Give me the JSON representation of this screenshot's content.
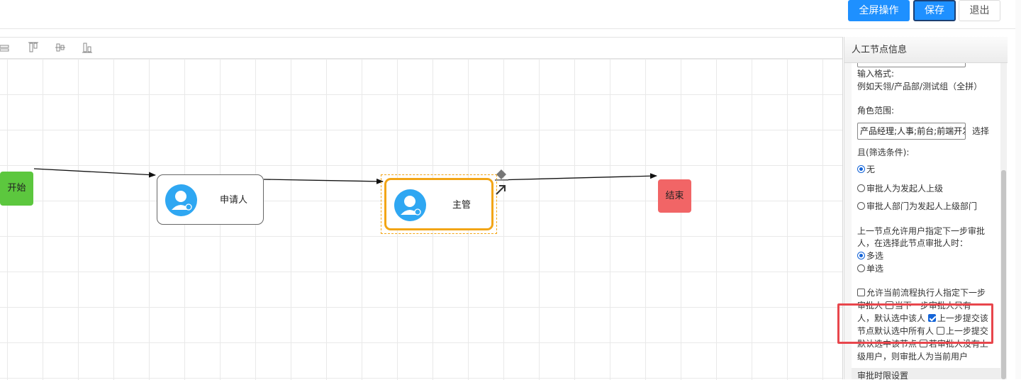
{
  "header": {
    "fullscreen_label": "全屏操作",
    "save_label": "保存",
    "exit_label": "退出"
  },
  "canvas": {
    "nodes": {
      "start": "开始",
      "applicant": "申请人",
      "manager": "主管",
      "end": "结束"
    }
  },
  "panel": {
    "title": "人工节点信息",
    "input_format_label": "输入格式:",
    "input_format_example": "例如天翎/产品部/测试组（全拼）",
    "role_scope_label": "角色范围:",
    "role_scope_value": "产品经理;人事;前台;前端开发",
    "select_label": "选择",
    "filter_label": "且(筛选条件):",
    "filter_options": [
      "无",
      "审批人为发起人上级",
      "审批人部门为发起人上级部门"
    ],
    "prev_node_text_1": "上一节点允许用户指定下一步审批",
    "prev_node_text_2": "人，在选择此节点审批人时：",
    "select_mode_options": [
      "多选",
      "单选"
    ],
    "allow_line_1": "允许当前流程执行人指定下一步",
    "allow_line_2a": "审批人",
    "allow_line_2b": "当下一步审批人只有一",
    "allow_line_3a": "人，默认选中该人",
    "allow_line_3b": "上一步提交该",
    "allow_line_4a": "节点默认选中所有人",
    "allow_line_4b": "上一步提交",
    "allow_line_5a": "默认选中该节点",
    "allow_line_5b": "若审批人没有上",
    "allow_line_6": "级用户，则审批人为当前用户",
    "next_section_label": "审批时限设置"
  }
}
